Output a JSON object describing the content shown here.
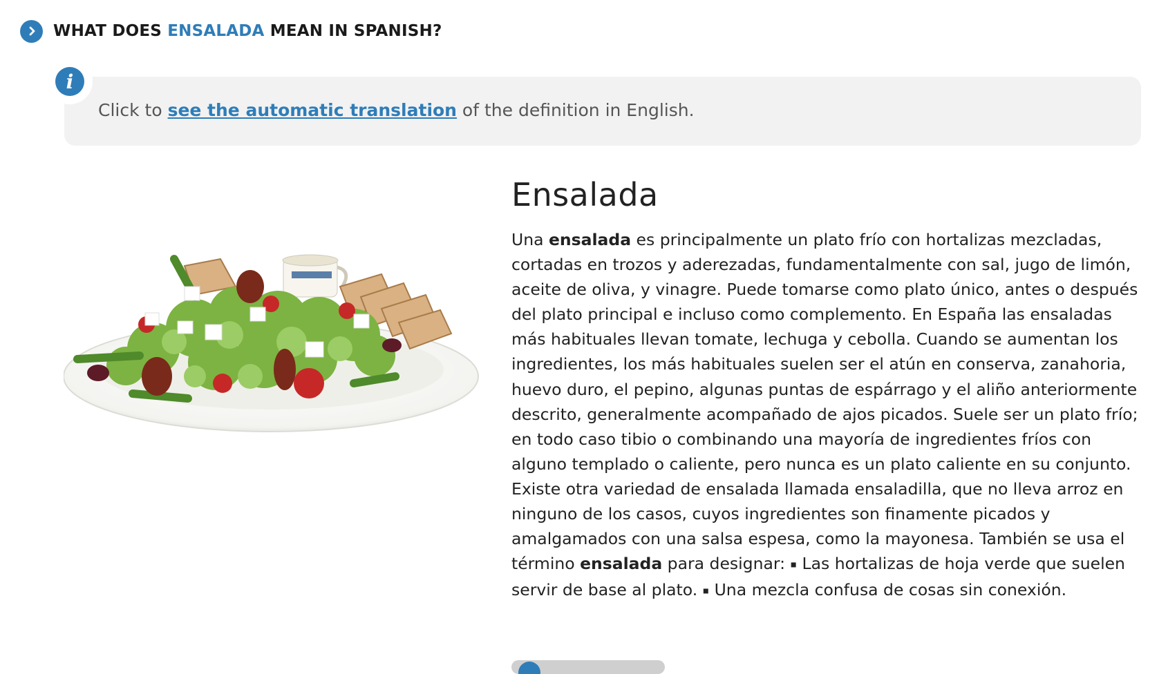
{
  "question": {
    "prefix": "WHAT DOES ",
    "word": "ENSALADA",
    "suffix": " MEAN IN SPANISH?",
    "icon": "chevron-right-icon"
  },
  "info": {
    "icon": "info-icon",
    "before": "Click to ",
    "link": "see the automatic translation",
    "after": " of the definition in English."
  },
  "definition": {
    "title": "Ensalada",
    "p1_a": "Una ",
    "p1_b": "ensalada",
    "p1_c": " es principalmente un plato frío con hortalizas mezcladas, cortadas en trozos y aderezadas, fundamentalmente con sal, jugo de limón, aceite de oliva, y vinagre. Puede tomarse como plato único, antes o después del plato principal e incluso como complemento. En España las ensaladas más habituales llevan tomate, lechuga y cebolla. Cuando se aumentan los ingredientes, los más habituales suelen ser el atún en conserva, zanahoria, huevo duro, el pepino, algunas puntas de espárrago y el aliño anteriormente descrito, generalmente acompañado de ajos picados. Suele ser un plato frío; en todo caso tibio o combinando una mayoría de ingredientes fríos con alguno templado o caliente, pero nunca es un plato caliente en su conjunto. Existe otra variedad de ensalada llamada ensaladilla, que no lleva arroz en ninguno de los casos, cuyos ingredientes son finamente picados y amalgamados con una salsa espesa, como la mayonesa.",
    "p2_a": " También se usa el término ",
    "p2_b": "ensalada",
    "p2_c": " para designar: ",
    "bullet1": " Las hortalizas de hoja verde que suelen servir de base al plato. ",
    "bullet2": " Una mezcla confusa de cosas sin conexión.",
    "bullet_mark": "▪"
  },
  "image": {
    "subject": "salad-plate-image"
  },
  "colors": {
    "accent": "#2f7db8",
    "box": "#f2f2f2"
  }
}
